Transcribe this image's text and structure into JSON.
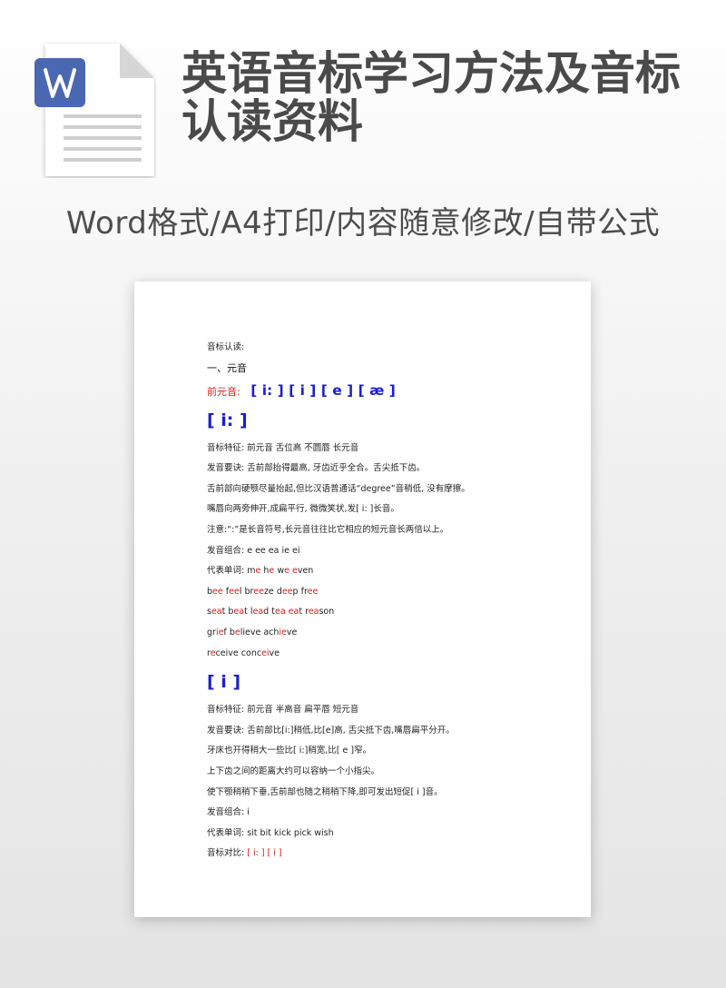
{
  "header": {
    "title": "英语音标学习方法及音标认读资料",
    "subtitle": "Word格式/A4打印/内容随意修改/自带公式"
  },
  "icon": {
    "name": "word-document-icon",
    "letter": "W",
    "accent": "#4a68b2"
  },
  "colors": {
    "red": "#d8201c",
    "blue": "#1a1ed2",
    "text": "#222222"
  },
  "document": {
    "heading": "音标认读:",
    "section": "一、元音",
    "front_vowels_label": "前元音:",
    "front_vowels": "[ i: ] [ i ] [ e ] [ æ ]",
    "phoneme1": {
      "symbol": "[ i: ]",
      "features": "音标特征: 前元音  舌位高  不圆唇  长元音",
      "req1": "发音要诀: 舌前部抬得最高, 牙齿近乎全合。舌尖抵下齿。",
      "req2": "舌前部向硬颚尽量抬起,但比汉语普通话“degree”音稍低, 没有摩擦。",
      "req3": "嘴唇向两旁伸开,成扁平行, 微微笑状,发[ i: ]长音。",
      "note": "注意:“:”是长音符号,长元音往往比它相应的短元音长两倍以上。",
      "combo": "发音组合: e ee ea ie ei",
      "words_label": "代表单词: ",
      "words_line1": "me he we even",
      "words_line2": "bee feel breeze deep free",
      "words_line3": "seat beat lead tea eat reason",
      "words_line4": "grief believe achieve",
      "words_line5": "receive conceive"
    },
    "phoneme2": {
      "symbol": "[ i ]",
      "features": "音标特征: 前元音  半高音  扁平唇  短元音",
      "req1": "发音要诀: 舌前部比[i:]稍低,比[e]高,  舌尖抵下齿,嘴唇扁平分开。",
      "req2": "牙床也开得稍大一些比[ i:]稍宽,比[ e ]窄。",
      "req3": "上下齿之间的距离大约可以容纳一个小指尖。",
      "req4": "使下颚稍稍下垂,舌前部也随之稍稍下降,即可发出短促[ i ]音。",
      "combo": "发音组合: i",
      "words": "代表单词: sit bit kick pick wish",
      "compare_label": "音标对比: ",
      "compare": "[ i: ] [ i ]"
    }
  }
}
